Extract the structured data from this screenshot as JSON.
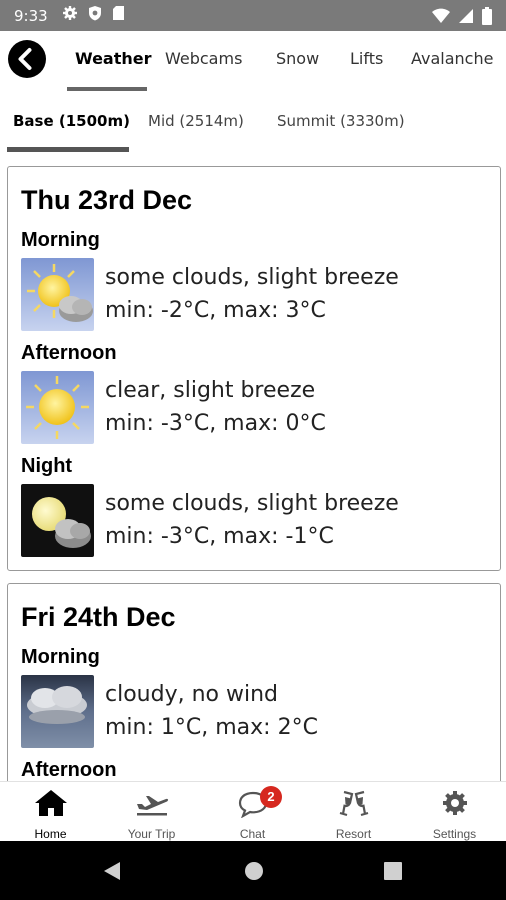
{
  "status_bar": {
    "time": "9:33"
  },
  "top_tabs": [
    "Weather",
    "Webcams",
    "Snow",
    "Lifts",
    "Avalanche"
  ],
  "altitude_tabs": [
    "Base (1500m)",
    "Mid (2514m)",
    "Summit (3330m)"
  ],
  "forecast": [
    {
      "day": "Thu 23rd Dec",
      "periods": [
        {
          "label": "Morning",
          "icon": "sun-cloud-icon",
          "conditions": "some clouds, slight breeze",
          "temps": "min: -2°C, max: 3°C"
        },
        {
          "label": "Afternoon",
          "icon": "sun-icon",
          "conditions": "clear, slight breeze",
          "temps": "min: -3°C, max: 0°C"
        },
        {
          "label": "Night",
          "icon": "moon-cloud-icon",
          "conditions": "some clouds, slight breeze",
          "temps": "min: -3°C, max: -1°C"
        }
      ]
    },
    {
      "day": "Fri 24th Dec",
      "periods": [
        {
          "label": "Morning",
          "icon": "cloud-icon",
          "conditions": "cloudy, no wind",
          "temps": "min: 1°C, max: 2°C"
        },
        {
          "label": "Afternoon"
        }
      ]
    }
  ],
  "bottom_nav": [
    {
      "label": "Home",
      "icon": "home-icon"
    },
    {
      "label": "Your Trip",
      "icon": "plane-icon"
    },
    {
      "label": "Chat",
      "icon": "chat-icon",
      "badge": "2"
    },
    {
      "label": "Resort",
      "icon": "cheers-icon"
    },
    {
      "label": "Settings",
      "icon": "gear-icon"
    }
  ],
  "colors": {
    "status_bar": "#7a7a7a",
    "badge": "#d6281f",
    "sky_day": "#9fb3e0",
    "sky_night": "#101010"
  }
}
